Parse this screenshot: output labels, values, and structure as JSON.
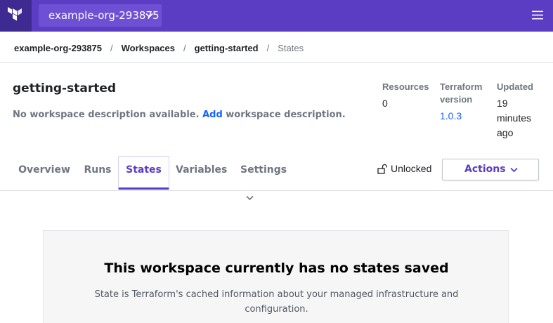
{
  "topbar": {
    "logo_icon": "terraform-logo-icon",
    "org_switcher_label": "example-org-293875",
    "menu_icon": "hamburger-menu-icon",
    "brand_color": "#5b3dc4"
  },
  "breadcrumb": {
    "items": [
      "example-org-293875",
      "Workspaces",
      "getting-started"
    ],
    "separator": "/",
    "current": "States"
  },
  "workspace": {
    "name": "getting-started",
    "desc_prefix": "No workspace description available.",
    "desc_link": "Add",
    "desc_suffix": "workspace description."
  },
  "meta": {
    "resources_label": "Resources",
    "resources_value": "0",
    "terraform_label_1": "Terraform",
    "terraform_label_2": "version",
    "terraform_value": "1.0.3",
    "updated_label": "Updated",
    "updated_value_1": "19",
    "updated_value_2": "minutes",
    "updated_value_3": "ago"
  },
  "tabs": {
    "overview": "Overview",
    "runs": "Runs",
    "states": "States",
    "variables": "Variables",
    "settings": "Settings",
    "active": "States"
  },
  "lock": {
    "icon": "unlocked-padlock-icon",
    "label": "Unlocked"
  },
  "actions": {
    "label": "Actions"
  },
  "empty_state": {
    "title": "This workspace currently has no states saved",
    "body": "State is Terraform's cached information about your managed infrastructure and configuration."
  }
}
